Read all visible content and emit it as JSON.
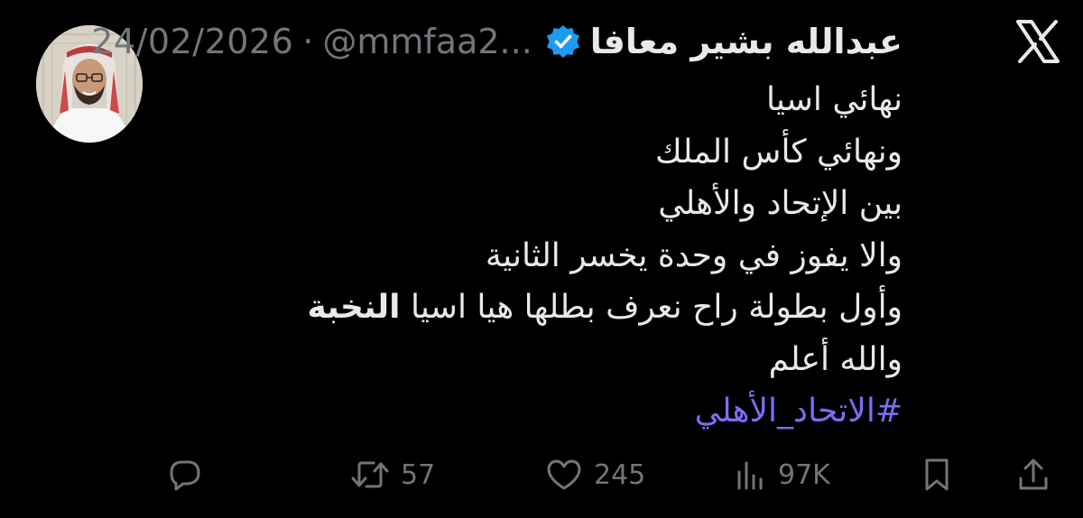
{
  "tweet": {
    "display_name": "عبدالله بشير معافا",
    "handle": "@mmfaa2...",
    "separator": "·",
    "date": "24/02/2026",
    "lines": [
      "نهائي اسيا",
      "ونهائي كأس الملك",
      "بين الإتحاد والأهلي",
      "والا يفوز في وحدة يخسر الثانية",
      "وأول بطولة راح نعرف بطلها هيا اسيا",
      "النخبة",
      "والله أعلم"
    ],
    "hashtag": "#الاتحاد_الأهلي"
  },
  "actions": {
    "retweets": "57",
    "likes": "245",
    "views": "97K"
  },
  "colors": {
    "background": "#000000",
    "text": "#e7e9ea",
    "muted": "#71767b",
    "hashtag": "#7d6cf6",
    "verified": "#1d9bf0"
  },
  "icons": [
    "x-logo-icon",
    "verified-badge-icon",
    "reply-icon",
    "retweet-icon",
    "like-icon",
    "views-icon",
    "bookmark-icon",
    "share-icon"
  ]
}
